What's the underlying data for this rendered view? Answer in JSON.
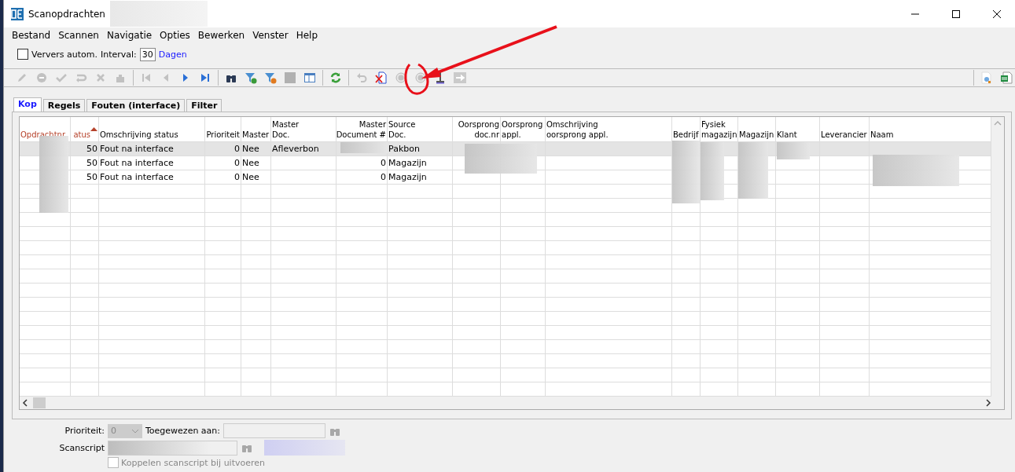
{
  "window": {
    "title": "Scanopdrachten"
  },
  "menu": [
    "Bestand",
    "Scannen",
    "Navigatie",
    "Opties",
    "Bewerken",
    "Venster",
    "Help"
  ],
  "refresh_bar": {
    "auto_refresh": {
      "label": "Ververs autom.",
      "checked": false
    },
    "interval_label": "Interval:",
    "interval_value": "30",
    "unit": "Dagen"
  },
  "toolbar": [
    {
      "kind": "pencil",
      "disabled": true
    },
    {
      "kind": "stop",
      "disabled": true
    },
    {
      "kind": "check",
      "disabled": true
    },
    {
      "kind": "redo",
      "disabled": true
    },
    {
      "kind": "cross",
      "disabled": true
    },
    {
      "kind": "puzzle",
      "disabled": true
    },
    {
      "kind": "first",
      "disabled": true
    },
    {
      "kind": "prev",
      "disabled": true
    },
    {
      "kind": "next",
      "disabled": false
    },
    {
      "kind": "last",
      "disabled": false
    },
    {
      "kind": "binoculars",
      "disabled": false
    },
    {
      "kind": "filter-add",
      "disabled": false
    },
    {
      "kind": "filter-remove",
      "disabled": false
    },
    {
      "kind": "square",
      "disabled": true
    },
    {
      "kind": "panel",
      "disabled": false
    },
    {
      "kind": "refresh",
      "disabled": false
    },
    {
      "kind": "undo",
      "disabled": true
    },
    {
      "kind": "delete-doc",
      "disabled": false
    },
    {
      "kind": "circle",
      "disabled": true
    },
    {
      "kind": "circle",
      "disabled": true
    },
    {
      "kind": "pin",
      "disabled": false
    },
    {
      "kind": "arrow",
      "disabled": true
    }
  ],
  "toolbar_right": [
    {
      "kind": "preview"
    },
    {
      "kind": "excel"
    }
  ],
  "tabs": [
    {
      "label": "Kop",
      "selected": true
    },
    {
      "label": "Regels",
      "selected": false
    },
    {
      "label": "Fouten (interface)",
      "selected": false
    },
    {
      "label": "Filter",
      "selected": false
    }
  ],
  "table": {
    "columns": [
      {
        "label": "Opdrachtnr.",
        "highlighted": true,
        "sorted": false
      },
      {
        "label": "atus",
        "highlighted": true,
        "sorted": true
      },
      {
        "label": "Omschrijving status",
        "highlighted": false,
        "sorted": false
      },
      {
        "label": "Prioriteit",
        "highlighted": false,
        "sorted": false
      },
      {
        "label": "Master",
        "highlighted": false,
        "sorted": false
      },
      {
        "label": "Master\nDoc.",
        "highlighted": false,
        "sorted": false
      },
      {
        "label": "Master\nDocument #",
        "highlighted": false,
        "sorted": false
      },
      {
        "label": "Source\nDoc.",
        "highlighted": false,
        "sorted": false
      },
      {
        "label": "Oorsprong\ndoc.nr",
        "highlighted": false,
        "sorted": false
      },
      {
        "label": "Oorsprong\nappl.",
        "highlighted": false,
        "sorted": false
      },
      {
        "label": "Omschrijving\noorsprong appl.",
        "highlighted": false,
        "sorted": false
      },
      {
        "label": "Bedrijf",
        "highlighted": false,
        "sorted": false
      },
      {
        "label": "Fysiek\nmagazijn",
        "highlighted": false,
        "sorted": false
      },
      {
        "label": "Magazijn",
        "highlighted": false,
        "sorted": false
      },
      {
        "label": "Klant",
        "highlighted": false,
        "sorted": false
      },
      {
        "label": "Leverancier",
        "highlighted": false,
        "sorted": false
      },
      {
        "label": "Naam",
        "highlighted": false,
        "sorted": false
      }
    ],
    "rows": [
      {
        "selected": true,
        "cells": [
          null,
          "50",
          "Fout na interface",
          "0",
          "Nee",
          "Afleverbon",
          null,
          "Pakbon",
          null,
          null,
          null,
          null,
          null,
          null,
          null,
          null,
          null
        ]
      },
      {
        "selected": false,
        "cells": [
          null,
          "50",
          "Fout na interface",
          "0",
          "Nee",
          null,
          "0",
          "Magazijn",
          null,
          null,
          null,
          null,
          null,
          null,
          null,
          null,
          null
        ]
      },
      {
        "selected": false,
        "cells": [
          null,
          "50",
          "Fout na interface",
          "0",
          "Nee",
          null,
          "0",
          "Magazijn",
          null,
          null,
          null,
          null,
          null,
          null,
          null,
          null,
          null
        ]
      }
    ]
  },
  "form": {
    "priority_label": "Prioriteit:",
    "priority_value": "0",
    "priority_disabled": true,
    "assigned_label": "Toegewezen aan:",
    "scanscript_label": "Scanscript",
    "link_checkbox": {
      "label": "Koppelen scanscript bij uitvoeren",
      "checked": false,
      "disabled": true
    }
  }
}
